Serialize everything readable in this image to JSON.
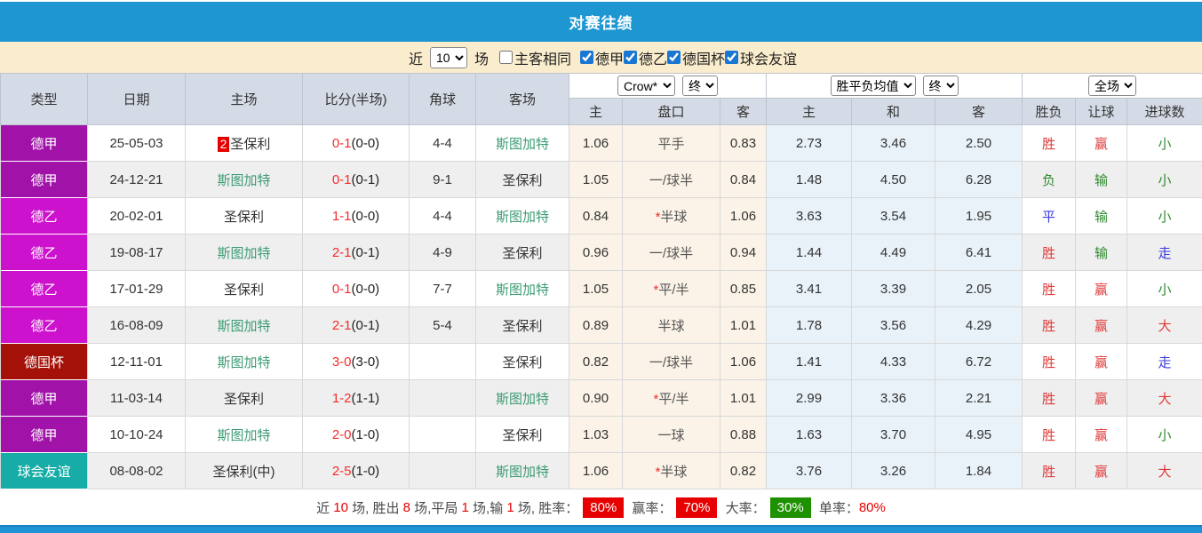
{
  "title": "对赛往绩",
  "filter": {
    "near_label": "近",
    "count_value": "10",
    "games_label": "场",
    "same_venue_label": "主客相同",
    "same_venue_checked": false,
    "leagues": [
      {
        "label": "德甲",
        "checked": true
      },
      {
        "label": "德乙",
        "checked": true
      },
      {
        "label": "德国杯",
        "checked": true
      },
      {
        "label": "球会友谊",
        "checked": true
      }
    ]
  },
  "table": {
    "headers": {
      "type": "类型",
      "date": "日期",
      "home": "主场",
      "score": "比分(半场)",
      "corners": "角球",
      "away": "客场"
    },
    "selects": {
      "odds_company": "Crow*",
      "odds_time": "终",
      "avg_metric": "胜平负均值",
      "avg_time": "终",
      "scope": "全场"
    },
    "sub_headers": {
      "odds_home": "主",
      "handicap": "盘口",
      "odds_away": "客",
      "avg_win": "主",
      "avg_draw": "和",
      "avg_lose": "客",
      "result": "胜负",
      "handicap_result": "让球",
      "goals": "进球数"
    },
    "rows": [
      {
        "type": "德甲",
        "type_color": "#A012A8",
        "date": "25-05-03",
        "home": "圣保利",
        "home_badge": "2",
        "home_green": false,
        "score_full": "0-1",
        "score_half": "(0-0)",
        "corners": "4-4",
        "away": "斯图加特",
        "away_green": true,
        "odds_home": "1.06",
        "handicap_star": false,
        "handicap": "平手",
        "odds_away": "0.83",
        "avg_win": "2.73",
        "avg_draw": "3.46",
        "avg_lose": "2.50",
        "result": "胜",
        "result_cls": "red",
        "let": "赢",
        "let_cls": "red",
        "goals": "小",
        "goals_cls": "green"
      },
      {
        "type": "德甲",
        "type_color": "#A012A8",
        "date": "24-12-21",
        "home": "斯图加特",
        "home_badge": "",
        "home_green": true,
        "score_full": "0-1",
        "score_half": "(0-1)",
        "corners": "9-1",
        "away": "圣保利",
        "away_green": false,
        "odds_home": "1.05",
        "handicap_star": false,
        "handicap": "一/球半",
        "odds_away": "0.84",
        "avg_win": "1.48",
        "avg_draw": "4.50",
        "avg_lose": "6.28",
        "result": "负",
        "result_cls": "green",
        "let": "输",
        "let_cls": "green",
        "goals": "小",
        "goals_cls": "green"
      },
      {
        "type": "德乙",
        "type_color": "#CC12CC",
        "date": "20-02-01",
        "home": "圣保利",
        "home_badge": "",
        "home_green": false,
        "score_full": "1-1",
        "score_half": "(0-0)",
        "corners": "4-4",
        "away": "斯图加特",
        "away_green": true,
        "odds_home": "0.84",
        "handicap_star": true,
        "handicap": "半球",
        "odds_away": "1.06",
        "avg_win": "3.63",
        "avg_draw": "3.54",
        "avg_lose": "1.95",
        "result": "平",
        "result_cls": "blue",
        "let": "输",
        "let_cls": "green",
        "goals": "小",
        "goals_cls": "green"
      },
      {
        "type": "德乙",
        "type_color": "#CC12CC",
        "date": "19-08-17",
        "home": "斯图加特",
        "home_badge": "",
        "home_green": true,
        "score_full": "2-1",
        "score_half": "(0-1)",
        "corners": "4-9",
        "away": "圣保利",
        "away_green": false,
        "odds_home": "0.96",
        "handicap_star": false,
        "handicap": "一/球半",
        "odds_away": "0.94",
        "avg_win": "1.44",
        "avg_draw": "4.49",
        "avg_lose": "6.41",
        "result": "胜",
        "result_cls": "red",
        "let": "输",
        "let_cls": "green",
        "goals": "走",
        "goals_cls": "blue"
      },
      {
        "type": "德乙",
        "type_color": "#CC12CC",
        "date": "17-01-29",
        "home": "圣保利",
        "home_badge": "",
        "home_green": false,
        "score_full": "0-1",
        "score_half": "(0-0)",
        "corners": "7-7",
        "away": "斯图加特",
        "away_green": true,
        "odds_home": "1.05",
        "handicap_star": true,
        "handicap": "平/半",
        "odds_away": "0.85",
        "avg_win": "3.41",
        "avg_draw": "3.39",
        "avg_lose": "2.05",
        "result": "胜",
        "result_cls": "red",
        "let": "赢",
        "let_cls": "red",
        "goals": "小",
        "goals_cls": "green"
      },
      {
        "type": "德乙",
        "type_color": "#CC12CC",
        "date": "16-08-09",
        "home": "斯图加特",
        "home_badge": "",
        "home_green": true,
        "score_full": "2-1",
        "score_half": "(0-1)",
        "corners": "5-4",
        "away": "圣保利",
        "away_green": false,
        "odds_home": "0.89",
        "handicap_star": false,
        "handicap": "半球",
        "odds_away": "1.01",
        "avg_win": "1.78",
        "avg_draw": "3.56",
        "avg_lose": "4.29",
        "result": "胜",
        "result_cls": "red",
        "let": "赢",
        "let_cls": "red",
        "goals": "大",
        "goals_cls": "red"
      },
      {
        "type": "德国杯",
        "type_color": "#A31108",
        "date": "12-11-01",
        "home": "斯图加特",
        "home_badge": "",
        "home_green": true,
        "score_full": "3-0",
        "score_half": "(3-0)",
        "corners": "",
        "away": "圣保利",
        "away_green": false,
        "odds_home": "0.82",
        "handicap_star": false,
        "handicap": "一/球半",
        "odds_away": "1.06",
        "avg_win": "1.41",
        "avg_draw": "4.33",
        "avg_lose": "6.72",
        "result": "胜",
        "result_cls": "red",
        "let": "赢",
        "let_cls": "red",
        "goals": "走",
        "goals_cls": "blue"
      },
      {
        "type": "德甲",
        "type_color": "#A012A8",
        "date": "11-03-14",
        "home": "圣保利",
        "home_badge": "",
        "home_green": false,
        "score_full": "1-2",
        "score_half": "(1-1)",
        "corners": "",
        "away": "斯图加特",
        "away_green": true,
        "odds_home": "0.90",
        "handicap_star": true,
        "handicap": "平/半",
        "odds_away": "1.01",
        "avg_win": "2.99",
        "avg_draw": "3.36",
        "avg_lose": "2.21",
        "result": "胜",
        "result_cls": "red",
        "let": "赢",
        "let_cls": "red",
        "goals": "大",
        "goals_cls": "red"
      },
      {
        "type": "德甲",
        "type_color": "#A012A8",
        "date": "10-10-24",
        "home": "斯图加特",
        "home_badge": "",
        "home_green": true,
        "score_full": "2-0",
        "score_half": "(1-0)",
        "corners": "",
        "away": "圣保利",
        "away_green": false,
        "odds_home": "1.03",
        "handicap_star": false,
        "handicap": "一球",
        "odds_away": "0.88",
        "avg_win": "1.63",
        "avg_draw": "3.70",
        "avg_lose": "4.95",
        "result": "胜",
        "result_cls": "red",
        "let": "赢",
        "let_cls": "red",
        "goals": "小",
        "goals_cls": "green"
      },
      {
        "type": "球会友谊",
        "type_color": "#17ADA6",
        "date": "08-08-02",
        "home": "圣保利(中)",
        "home_badge": "",
        "home_green": false,
        "score_full": "2-5",
        "score_half": "(1-0)",
        "corners": "",
        "away": "斯图加特",
        "away_green": true,
        "odds_home": "1.06",
        "handicap_star": true,
        "handicap": "半球",
        "odds_away": "0.82",
        "avg_win": "3.76",
        "avg_draw": "3.26",
        "avg_lose": "1.84",
        "result": "胜",
        "result_cls": "red",
        "let": "赢",
        "let_cls": "red",
        "goals": "大",
        "goals_cls": "red"
      }
    ]
  },
  "summary": {
    "tokens": [
      {
        "t": "plain",
        "v": "近 "
      },
      {
        "t": "num",
        "v": "10"
      },
      {
        "t": "plain",
        "v": " 场, 胜出 "
      },
      {
        "t": "num",
        "v": "8"
      },
      {
        "t": "plain",
        "v": " 场,平局 "
      },
      {
        "t": "num",
        "v": "1"
      },
      {
        "t": "plain",
        "v": " 场,输 "
      },
      {
        "t": "num",
        "v": "1"
      },
      {
        "t": "plain",
        "v": " 场, 胜率："
      },
      {
        "t": "badge_red",
        "v": "80%"
      },
      {
        "t": "plain",
        "v": " 赢率："
      },
      {
        "t": "badge_red",
        "v": "70%"
      },
      {
        "t": "plain",
        "v": " 大率："
      },
      {
        "t": "badge_green",
        "v": "30%"
      },
      {
        "t": "plain",
        "v": " 单率："
      },
      {
        "t": "num",
        "v": "80%"
      }
    ]
  },
  "colors": {
    "topbar_blue": "#1E96D2",
    "filter_bg": "#FAEDCD",
    "header_bg": "#D5DBE6",
    "league_bundesliga": "#A012A8",
    "league_bundesliga2": "#CC12CC",
    "league_dfb_pokal": "#A31108",
    "league_club_friendly": "#17ADA6",
    "accent_red": "#E60000",
    "accent_green": "#1E9100",
    "odds_section_bg": "#FBF3E7",
    "avg_section_bg": "#E9F2F9"
  }
}
